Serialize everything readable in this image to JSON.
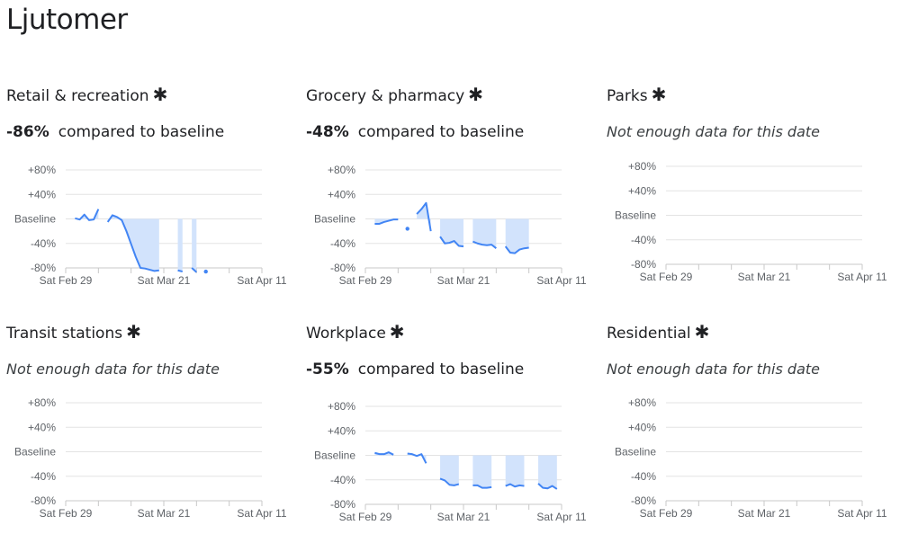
{
  "page_title": "Ljutomer",
  "comparison_text": "compared to baseline",
  "no_data_text": "Not enough data for this date",
  "colors": {
    "line": "#4285f4",
    "fill": "#d2e3fc",
    "grid": "#e3e3e3",
    "axis": "#c8c8c8"
  },
  "chart_data": [
    {
      "type": "line",
      "title": "Retail & recreation",
      "value": "-86%",
      "has_data": true,
      "y_ticks": [
        "+80%",
        "+40%",
        "Baseline",
        "-40%",
        "-80%"
      ],
      "ylim": [
        -80,
        80
      ],
      "x_ticks": [
        "Sat Feb 29",
        "Sat Mar 21",
        "Sat Apr 11"
      ],
      "xlim": [
        "2020-02-29",
        "2020-04-11"
      ],
      "segments": [
        [
          [
            "2020-03-02",
            1
          ],
          [
            "2020-03-03",
            -1
          ],
          [
            "2020-03-04",
            7
          ],
          [
            "2020-03-05",
            -2
          ],
          [
            "2020-03-06",
            -1
          ],
          [
            "2020-03-07",
            16
          ]
        ],
        [
          [
            "2020-03-09",
            -5
          ],
          [
            "2020-03-10",
            6
          ],
          [
            "2020-03-11",
            3
          ],
          [
            "2020-03-12",
            -2
          ],
          [
            "2020-03-13",
            -20
          ],
          [
            "2020-03-14",
            -41
          ],
          [
            "2020-03-15",
            -62
          ],
          [
            "2020-03-16",
            -80
          ],
          [
            "2020-03-17",
            -81
          ],
          [
            "2020-03-18",
            -83
          ],
          [
            "2020-03-19",
            -85
          ],
          [
            "2020-03-20",
            -84
          ]
        ],
        [
          [
            "2020-03-24",
            -84
          ],
          [
            "2020-03-25",
            -86
          ]
        ],
        [
          [
            "2020-03-27",
            -80
          ],
          [
            "2020-03-28",
            -87
          ]
        ],
        [
          [
            "2020-03-30",
            -86
          ]
        ]
      ]
    },
    {
      "type": "line",
      "title": "Grocery & pharmacy",
      "value": "-48%",
      "has_data": true,
      "y_ticks": [
        "+80%",
        "+40%",
        "Baseline",
        "-40%",
        "-80%"
      ],
      "ylim": [
        -80,
        80
      ],
      "x_ticks": [
        "Sat Feb 29",
        "Sat Mar 21",
        "Sat Apr 11"
      ],
      "xlim": [
        "2020-02-29",
        "2020-04-11"
      ],
      "segments": [
        [
          [
            "2020-03-02",
            -8
          ],
          [
            "2020-03-03",
            -8
          ],
          [
            "2020-03-04",
            -5
          ],
          [
            "2020-03-05",
            -3
          ],
          [
            "2020-03-06",
            -1
          ],
          [
            "2020-03-07",
            -1
          ]
        ],
        [
          [
            "2020-03-09",
            -16
          ]
        ],
        [
          [
            "2020-03-11",
            8
          ],
          [
            "2020-03-12",
            16
          ],
          [
            "2020-03-13",
            26
          ],
          [
            "2020-03-14",
            -20
          ]
        ],
        [
          [
            "2020-03-16",
            -29
          ],
          [
            "2020-03-17",
            -40
          ],
          [
            "2020-03-18",
            -39
          ],
          [
            "2020-03-19",
            -36
          ],
          [
            "2020-03-20",
            -44
          ],
          [
            "2020-03-21",
            -45
          ]
        ],
        [
          [
            "2020-03-23",
            -37
          ],
          [
            "2020-03-24",
            -40
          ],
          [
            "2020-03-25",
            -42
          ],
          [
            "2020-03-26",
            -43
          ],
          [
            "2020-03-27",
            -42
          ],
          [
            "2020-03-28",
            -48
          ]
        ],
        [
          [
            "2020-03-30",
            -45
          ],
          [
            "2020-03-31",
            -55
          ],
          [
            "2020-04-01",
            -56
          ],
          [
            "2020-04-02",
            -50
          ],
          [
            "2020-04-03",
            -48
          ],
          [
            "2020-04-04",
            -47
          ]
        ]
      ]
    },
    {
      "type": "line",
      "title": "Parks",
      "value": "",
      "has_data": false,
      "y_ticks": [
        "+80%",
        "+40%",
        "Baseline",
        "-40%",
        "-80%"
      ],
      "ylim": [
        -80,
        80
      ],
      "x_ticks": [
        "Sat Feb 29",
        "Sat Mar 21",
        "Sat Apr 11"
      ],
      "xlim": [
        "2020-02-29",
        "2020-04-11"
      ],
      "segments": []
    },
    {
      "type": "line",
      "title": "Transit stations",
      "value": "",
      "has_data": false,
      "y_ticks": [
        "+80%",
        "+40%",
        "Baseline",
        "-40%",
        "-80%"
      ],
      "ylim": [
        -80,
        80
      ],
      "x_ticks": [
        "Sat Feb 29",
        "Sat Mar 21",
        "Sat Apr 11"
      ],
      "xlim": [
        "2020-02-29",
        "2020-04-11"
      ],
      "segments": []
    },
    {
      "type": "line",
      "title": "Workplace",
      "value": "-55%",
      "has_data": true,
      "y_ticks": [
        "+80%",
        "+40%",
        "Baseline",
        "-40%",
        "-80%"
      ],
      "ylim": [
        -80,
        80
      ],
      "x_ticks": [
        "Sat Feb 29",
        "Sat Mar 21",
        "Sat Apr 11"
      ],
      "xlim": [
        "2020-02-29",
        "2020-04-11"
      ],
      "segments": [
        [
          [
            "2020-03-02",
            4
          ],
          [
            "2020-03-03",
            2
          ],
          [
            "2020-03-04",
            2
          ],
          [
            "2020-03-05",
            5
          ],
          [
            "2020-03-06",
            1
          ]
        ],
        [
          [
            "2020-03-09",
            3
          ],
          [
            "2020-03-10",
            2
          ],
          [
            "2020-03-11",
            -1
          ],
          [
            "2020-03-12",
            2
          ],
          [
            "2020-03-13",
            -13
          ]
        ],
        [
          [
            "2020-03-16",
            -38
          ],
          [
            "2020-03-17",
            -41
          ],
          [
            "2020-03-18",
            -48
          ],
          [
            "2020-03-19",
            -49
          ],
          [
            "2020-03-20",
            -47
          ]
        ],
        [
          [
            "2020-03-23",
            -49
          ],
          [
            "2020-03-24",
            -49
          ],
          [
            "2020-03-25",
            -53
          ],
          [
            "2020-03-26",
            -53
          ],
          [
            "2020-03-27",
            -52
          ]
        ],
        [
          [
            "2020-03-30",
            -50
          ],
          [
            "2020-03-31",
            -47
          ],
          [
            "2020-04-01",
            -51
          ],
          [
            "2020-04-02",
            -49
          ],
          [
            "2020-04-03",
            -50
          ]
        ],
        [
          [
            "2020-04-06",
            -46
          ],
          [
            "2020-04-07",
            -53
          ],
          [
            "2020-04-08",
            -54
          ],
          [
            "2020-04-09",
            -50
          ],
          [
            "2020-04-10",
            -55
          ]
        ]
      ]
    },
    {
      "type": "line",
      "title": "Residential",
      "value": "",
      "has_data": false,
      "y_ticks": [
        "+80%",
        "+40%",
        "Baseline",
        "-40%",
        "-80%"
      ],
      "ylim": [
        -80,
        80
      ],
      "x_ticks": [
        "Sat Feb 29",
        "Sat Mar 21",
        "Sat Apr 11"
      ],
      "xlim": [
        "2020-02-29",
        "2020-04-11"
      ],
      "segments": []
    }
  ]
}
